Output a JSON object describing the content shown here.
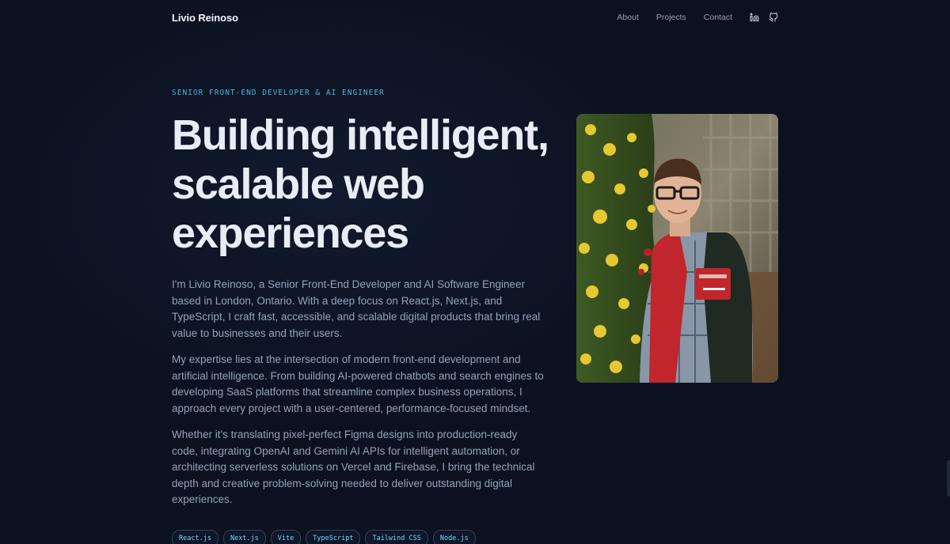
{
  "nav": {
    "brand": "Livio Reinoso",
    "links": [
      "About",
      "Projects",
      "Contact"
    ],
    "icons": [
      "linkedin-icon",
      "github-icon"
    ]
  },
  "hero": {
    "eyebrow": "SENIOR FRONT-END DEVELOPER & AI ENGINEER",
    "headline": "Building intelligent, scalable web experiences",
    "paragraphs": [
      "I'm Livio Reinoso, a Senior Front-End Developer and AI Software Engineer based in London, Ontario. With a deep focus on React.js, Next.js, and TypeScript, I craft fast, accessible, and scalable digital products that bring real value to businesses and their users.",
      "My expertise lies at the intersection of modern front-end development and artificial intelligence. From building AI-powered chatbots and search engines to developing SaaS platforms that streamline complex business operations, I approach every project with a user-centered, performance-focused mindset.",
      "Whether it's translating pixel-perfect Figma designs into production-ready code, integrating OpenAI and Gemini AI APIs for intelligent automation, or architecting serverless solutions on Vercel and Firebase, I bring the technical depth and creative problem-solving needed to deliver outstanding digital experiences."
    ],
    "tags": [
      "React.js",
      "Next.js",
      "Vite",
      "TypeScript",
      "Tailwind CSS",
      "Node.js"
    ]
  },
  "colors": {
    "background": "#0b1120",
    "accent": "#4fb3d9",
    "text_primary": "#e8edf5",
    "text_muted": "#94a3b8"
  }
}
